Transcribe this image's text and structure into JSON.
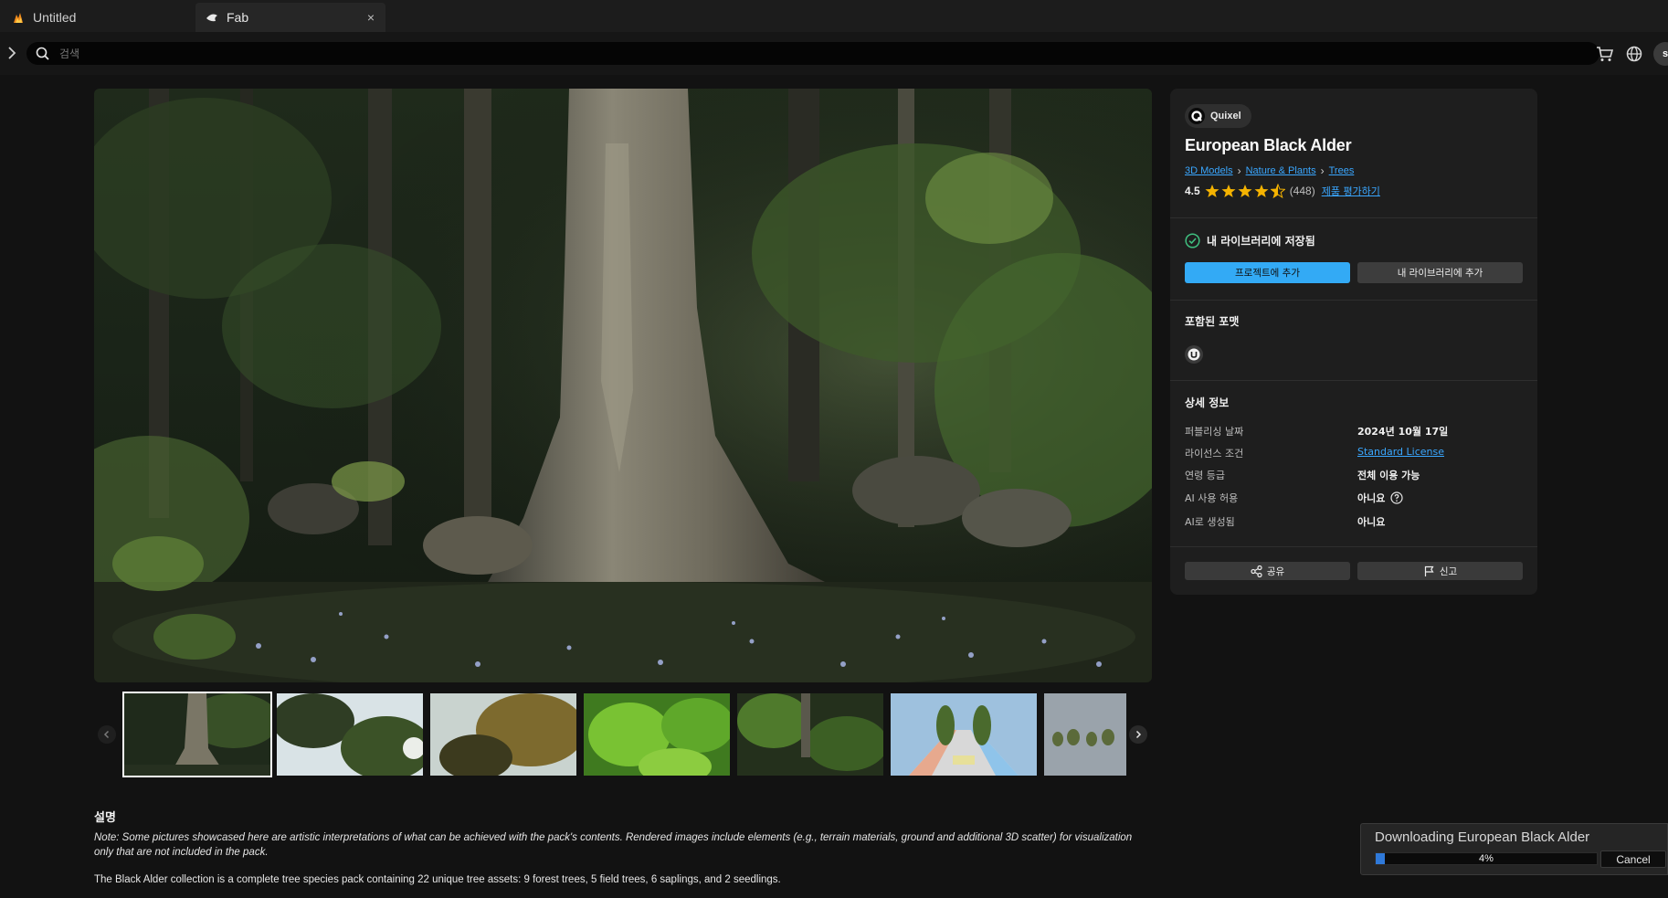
{
  "tabs": [
    {
      "label": "Untitled"
    },
    {
      "label": "Fab",
      "close": "×"
    }
  ],
  "search": {
    "placeholder": "검색"
  },
  "user": {
    "avatar_initial": "s"
  },
  "product": {
    "publisher": "Quixel",
    "title": "European Black Alder",
    "breadcrumbs": [
      "3D Models",
      "Nature & Plants",
      "Trees"
    ],
    "rating": "4.5",
    "rating_count": "(448)",
    "rate_link": "제품 평가하기",
    "owned_text": "내 라이브러리에 저장됨",
    "add_to_project": "프로젝트에 추가",
    "add_to_library": "내 라이브러리에 추가",
    "formats_heading": "포함된 포맷",
    "format_icon": "unreal-engine-icon",
    "details_heading": "상세 정보",
    "details": [
      {
        "label": "퍼블리싱 날짜",
        "value": "2024년 10월 17일"
      },
      {
        "label": "라이선스 조건",
        "value": "Standard License"
      },
      {
        "label": "연령 등급",
        "value": "전체 이용 가능"
      },
      {
        "label": "AI 사용 허용",
        "value": "아니요"
      },
      {
        "label": "AI로 생성됨",
        "value": "아니요"
      }
    ],
    "share": "공유",
    "report": "신고"
  },
  "gallery": {
    "thumbnail_count": 7,
    "selected_index": 0
  },
  "description": {
    "heading": "설명",
    "note": "Note: Some pictures showcased here are artistic interpretations of what can be achieved with the pack's contents. Rendered images include elements (e.g., terrain materials, ground and additional 3D scatter) for visualization only that are not included in the pack.",
    "body": "The Black Alder collection is a complete tree species pack containing 22 unique tree assets: 9 forest trees, 5 field trees, 6 saplings, and 2 seedlings."
  },
  "download": {
    "title": "Downloading European Black Alder",
    "progress_text": "4%",
    "progress_fraction": 0.04,
    "cancel": "Cancel"
  },
  "colors": {
    "accent_blue": "#33aaf5",
    "link_blue": "#3aa7ff",
    "star_gold": "#f5b301",
    "success_green": "#3fbf7f",
    "background": "#121212",
    "panel": "#1e1e1e"
  }
}
